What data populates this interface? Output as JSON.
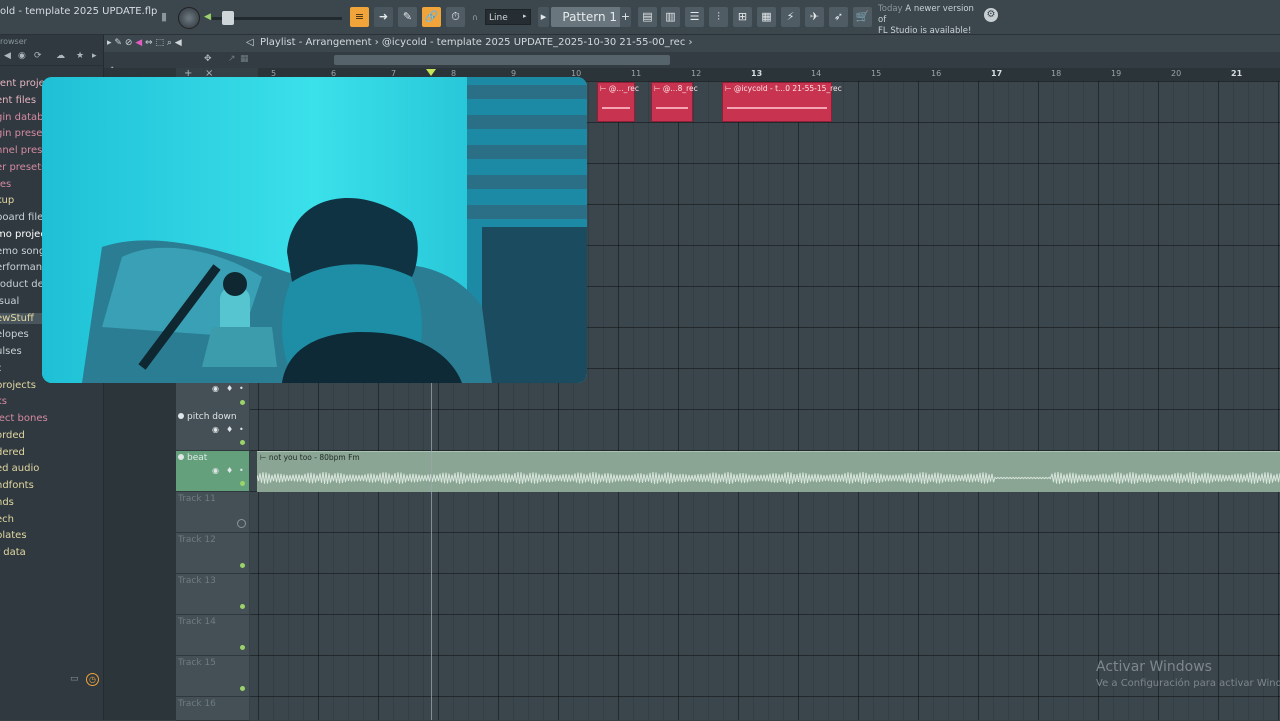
{
  "window": {
    "title": "old - template 2025 UPDATE.flp"
  },
  "toolbar": {
    "snap_value": "Line",
    "pattern_label": "Pattern 1",
    "news_today": "Today",
    "news_text_1": "A newer version of",
    "news_text_2": "FL Studio is available!",
    "accent": "#f0a43a"
  },
  "sidebar": {
    "title": "rowser",
    "items": [
      {
        "label": "rent projects",
        "color": "#e6b4c1"
      },
      {
        "label": "ent files",
        "color": "#e6b4c1"
      },
      {
        "label": "gin database",
        "color": "#d78aa3"
      },
      {
        "label": "gin presets",
        "color": "#d78aa3"
      },
      {
        "label": "nnel presets",
        "color": "#d78aa3"
      },
      {
        "label": "er presets",
        "color": "#d78aa3"
      },
      {
        "label": "res",
        "color": "#d78aa3"
      },
      {
        "label": "kup",
        "color": "#e2d7a2"
      },
      {
        "label": "board files",
        "color": "#c9d2d6"
      },
      {
        "label": "mo projects",
        "color": "#ffffff"
      },
      {
        "label": "emo songs",
        "color": "#c9d2d6"
      },
      {
        "label": "erformance",
        "color": "#c9d2d6"
      },
      {
        "label": "roduct demos",
        "color": "#c9d2d6"
      },
      {
        "label": "isual",
        "color": "#c9d2d6"
      },
      {
        "label": "ewStuff",
        "color": "#e2d7a2"
      },
      {
        "label": "elopes",
        "color": "#c9d2d6"
      },
      {
        "label": "ulses",
        "color": "#c9d2d6"
      },
      {
        "label": "c",
        "color": "#c9d2d6"
      },
      {
        "label": "projects",
        "color": "#e2d7a2"
      },
      {
        "label": "ks",
        "color": "#d78aa3"
      },
      {
        "label": "ject bones",
        "color": "#d78aa3"
      },
      {
        "label": "orded",
        "color": "#e2d7a2"
      },
      {
        "label": "dered",
        "color": "#e2d7a2"
      },
      {
        "label": "ed audio",
        "color": "#e2d7a2"
      },
      {
        "label": "ndfonts",
        "color": "#e2d7a2"
      },
      {
        "label": "nds",
        "color": "#e2d7a2"
      },
      {
        "label": "ech",
        "color": "#e2d7a2"
      },
      {
        "label": "plates",
        "color": "#e2d7a2"
      },
      {
        "label": "r data",
        "color": "#e2d7a2"
      }
    ]
  },
  "playlist": {
    "breadcrumb": "Playlist - Arrangement › @icycold - template 2025 UPDATE_2025-10-30 21-55-00_rec ›",
    "bar_numbers": [
      "5",
      "6",
      "7",
      "8",
      "9",
      "10",
      "11",
      "12",
      "13",
      "14",
      "15",
      "16",
      "17",
      "18",
      "19",
      "20",
      "21"
    ],
    "tracks": [
      {
        "name": "pitch down",
        "type": "named"
      },
      {
        "name": "beat",
        "type": "beat"
      },
      {
        "name": "Track 11",
        "type": "empty"
      },
      {
        "name": "Track 12",
        "type": "empty"
      },
      {
        "name": "Track 13",
        "type": "empty"
      },
      {
        "name": "Track 14",
        "type": "empty"
      },
      {
        "name": "Track 15",
        "type": "empty"
      },
      {
        "name": "Track 16",
        "type": "empty"
      }
    ],
    "clips": [
      {
        "label": "@..._rec"
      },
      {
        "label": "@...8_rec"
      },
      {
        "label": "@icycold - t...0 21-55-15_rec"
      }
    ],
    "beat_clip_label": "not you too - 80bpm Fm",
    "clip_color": "#c8334f",
    "beat_color": "#8aa594"
  },
  "watermark": {
    "title": "Activar Windows",
    "subtitle": "Ve a Configuración para activar Windows."
  }
}
